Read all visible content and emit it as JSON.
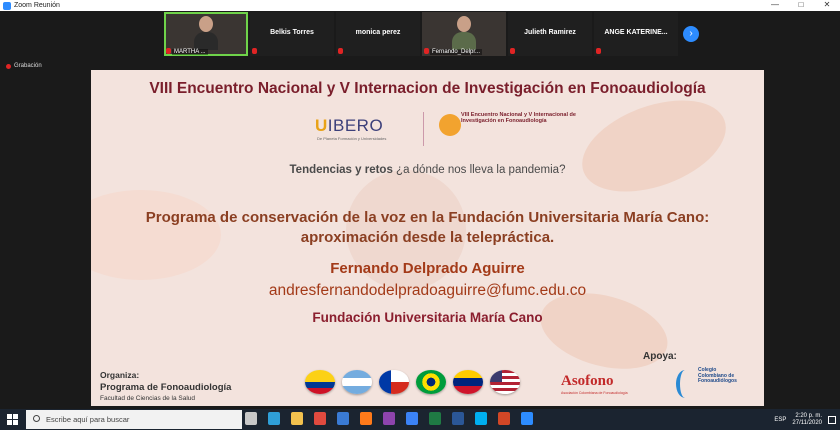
{
  "window": {
    "title": "Zoom Reunión",
    "controls": [
      "—",
      "□",
      "✕"
    ]
  },
  "participants": [
    {
      "name": "MARTHA ...",
      "video": true,
      "active": true,
      "shirt": "#2a2a2a",
      "muted": true
    },
    {
      "name": "Belkis Torres",
      "video": false,
      "muted": true
    },
    {
      "name": "monica perez",
      "video": false,
      "muted": true
    },
    {
      "name": "Fernando_Delpr...",
      "video": true,
      "active": false,
      "shirt": "#5b6b4a",
      "muted": true
    },
    {
      "name": "Julieth Ramirez",
      "video": false,
      "muted": true
    },
    {
      "name": "ANGE KATERINE...",
      "video": false,
      "muted": true
    }
  ],
  "next_icon": "chevron-right-icon",
  "recording": {
    "label": "Grabación"
  },
  "slide": {
    "title": "VIII Encuentro Nacional y V Internacion de Investigación en Fonoaudiología",
    "ibero": {
      "logo": "IBERO",
      "sub": "De Planeta Formación y Universidades"
    },
    "encuentro_logo_text": "VIII Encuentro Nacional y V Internacional de Investigación en Fonoaudiología",
    "tagline_bold": "Tendencias y retos",
    "tagline_rest": " ¿a dónde nos lleva la pandemia?",
    "talk_title": "Programa de conservación de la voz en la Fundación Universitaria María Cano: aproximación desde la telepráctica.",
    "speaker": "Fernando Delprado Aguirre",
    "email": "andresfernandodelpradoaguirre@fumc.edu.co",
    "institution": "Fundación Universitaria María Cano",
    "organiza_label": "Organiza:",
    "program": "Programa de Fonoaudiología",
    "faculty": "Facultad de Ciencias de la Salud",
    "flags": [
      "colombia-flag-icon",
      "argentina-flag-icon",
      "chile-flag-icon",
      "brazil-flag-icon",
      "venezuela-flag-icon",
      "usa-flag-icon"
    ],
    "apoya_label": "Apoya:",
    "asofono": "Asofono",
    "asofono_sub": "Asociación Colombiana de Fonoaudiología",
    "colegio": "Colegio Colombiano de Fonoaudiólogos"
  },
  "taskbar": {
    "search_placeholder": "Escribe aquí para buscar",
    "apps": [
      {
        "name": "task-view-icon",
        "color": "#c8c8c8"
      },
      {
        "name": "edge-icon",
        "color": "#2f9fd8"
      },
      {
        "name": "file-explorer-icon",
        "color": "#f2c14e"
      },
      {
        "name": "chrome-icon",
        "color": "#e04a3f"
      },
      {
        "name": "mail-icon",
        "color": "#3a7bd5"
      },
      {
        "name": "firefox-icon",
        "color": "#ff7a1a"
      },
      {
        "name": "onenote-icon",
        "color": "#8e44ad"
      },
      {
        "name": "store-icon",
        "color": "#3b82f6"
      },
      {
        "name": "excel-icon",
        "color": "#1f7a44"
      },
      {
        "name": "word-icon",
        "color": "#2b5797"
      },
      {
        "name": "skype-icon",
        "color": "#00aff0"
      },
      {
        "name": "powerpoint-icon",
        "color": "#d24726"
      },
      {
        "name": "zoom-icon",
        "color": "#2d8cff"
      }
    ],
    "language": "ESP",
    "time": "2:20 p. m.",
    "date": "27/11/2020"
  }
}
